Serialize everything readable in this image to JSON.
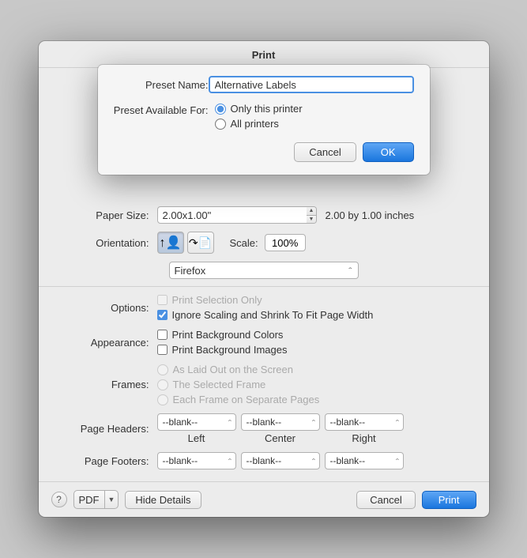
{
  "dialog": {
    "title": "Print",
    "preset_modal": {
      "preset_name_label": "Preset Name:",
      "preset_name_value": "Alternative Labels",
      "preset_available_label": "Preset Available For:",
      "radio_only_this": "Only this printer",
      "radio_all": "All printers",
      "cancel_label": "Cancel",
      "ok_label": "OK"
    },
    "paper_size_label": "Paper Size:",
    "paper_size_value": "2.00x1.00\"",
    "paper_size_info": "2.00 by 1.00 inches",
    "orientation_label": "Orientation:",
    "portrait_icon": "↑👤",
    "landscape_icon": "↷📄",
    "scale_label": "Scale:",
    "scale_value": "100%",
    "firefox_option": "Firefox",
    "options_label": "Options:",
    "print_selection_label": "Print Selection Only",
    "ignore_scaling_label": "Ignore Scaling and Shrink To Fit Page Width",
    "appearance_label": "Appearance:",
    "print_bg_colors_label": "Print Background Colors",
    "print_bg_images_label": "Print Background Images",
    "frames_label": "Frames:",
    "frame_as_laid_out": "As Laid Out on the Screen",
    "frame_selected": "The Selected Frame",
    "frame_each_separate": "Each Frame on Separate Pages",
    "page_headers_label": "Page Headers:",
    "page_footers_label": "Page Footers:",
    "blank_option": "--blank--",
    "left_label": "Left",
    "center_label": "Center",
    "right_label": "Right",
    "help_label": "?",
    "pdf_label": "PDF",
    "hide_details_label": "Hide Details",
    "cancel_bottom_label": "Cancel",
    "print_label": "Print"
  }
}
